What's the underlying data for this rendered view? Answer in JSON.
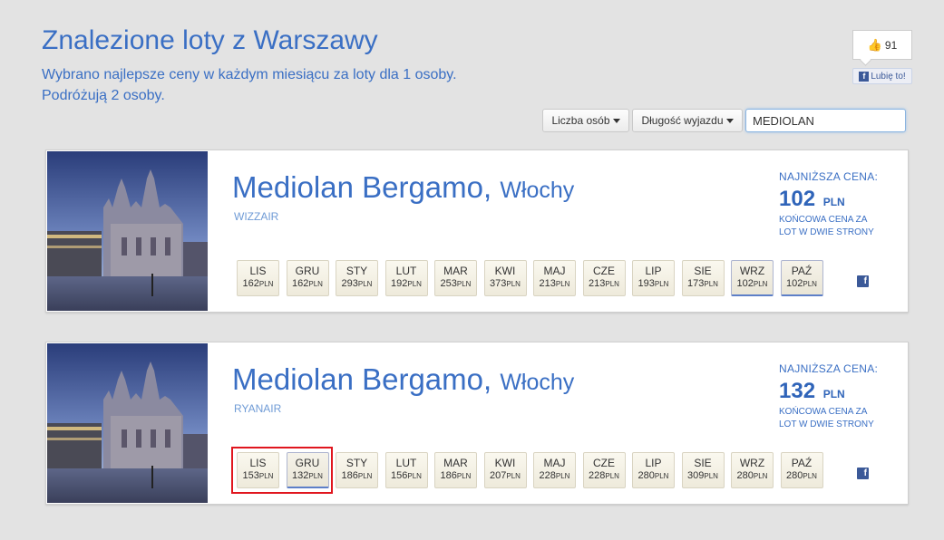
{
  "header": {
    "title": "Znalezione loty z Warszawy",
    "subtitle_line1": "Wybrano najlepsze ceny w każdym miesiącu za loty dla 1 osoby.",
    "subtitle_line2": "Podróżują 2 osoby."
  },
  "facebook": {
    "like_count": "91",
    "like_button": "Lubię to!",
    "icon": "facebook-icon"
  },
  "filters": {
    "persons_label": "Liczba osób",
    "length_label": "Długość wyjazdu",
    "destination_value": "MEDIOLAN"
  },
  "colors": {
    "accent": "#3a6fc4",
    "background": "#e3e3e3",
    "highlight": "#e0161e",
    "facebook": "#3b5998"
  },
  "results": [
    {
      "city": "Mediolan Bergamo,",
      "country": "Włochy",
      "airline": "WIZZAIR",
      "lowest_label": "NAJNIŻSZA CENA:",
      "lowest_price": "102",
      "currency": "PLN",
      "note_line1": "KOŃCOWA CENA ZA",
      "note_line2": "LOT W DWIE STRONY",
      "months": [
        {
          "m": "LIS",
          "p": "162"
        },
        {
          "m": "GRU",
          "p": "162"
        },
        {
          "m": "STY",
          "p": "293"
        },
        {
          "m": "LUT",
          "p": "192"
        },
        {
          "m": "MAR",
          "p": "253"
        },
        {
          "m": "KWI",
          "p": "373"
        },
        {
          "m": "MAJ",
          "p": "213"
        },
        {
          "m": "CZE",
          "p": "213"
        },
        {
          "m": "LIP",
          "p": "193"
        },
        {
          "m": "SIE",
          "p": "173"
        },
        {
          "m": "WRZ",
          "p": "102"
        },
        {
          "m": "PAŹ",
          "p": "102"
        }
      ]
    },
    {
      "city": "Mediolan Bergamo,",
      "country": "Włochy",
      "airline": "RYANAIR",
      "lowest_label": "NAJNIŻSZA CENA:",
      "lowest_price": "132",
      "currency": "PLN",
      "note_line1": "KOŃCOWA CENA ZA",
      "note_line2": "LOT W DWIE STRONY",
      "months": [
        {
          "m": "LIS",
          "p": "153"
        },
        {
          "m": "GRU",
          "p": "132"
        },
        {
          "m": "STY",
          "p": "186"
        },
        {
          "m": "LUT",
          "p": "156"
        },
        {
          "m": "MAR",
          "p": "186"
        },
        {
          "m": "KWI",
          "p": "207"
        },
        {
          "m": "MAJ",
          "p": "228"
        },
        {
          "m": "CZE",
          "p": "228"
        },
        {
          "m": "LIP",
          "p": "280"
        },
        {
          "m": "SIE",
          "p": "309"
        },
        {
          "m": "WRZ",
          "p": "280"
        },
        {
          "m": "PAŹ",
          "p": "280"
        }
      ]
    }
  ]
}
